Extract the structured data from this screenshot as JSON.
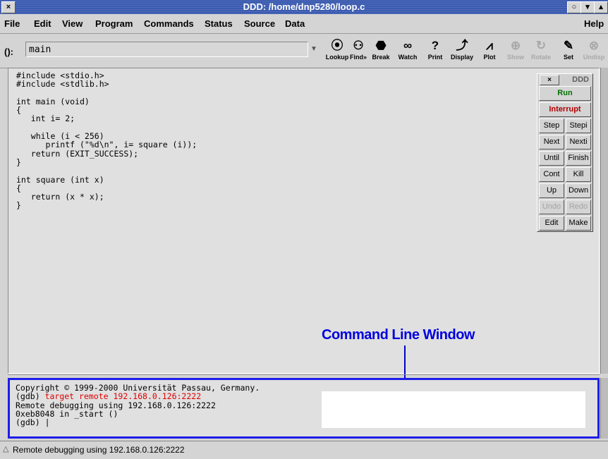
{
  "window": {
    "title": "DDD: /home/dnp5280/loop.c"
  },
  "titlebar_buttons": {
    "left": "×",
    "right": [
      "○",
      "▾",
      "▴"
    ]
  },
  "menu": {
    "items": [
      "File",
      "Edit",
      "View",
      "Program",
      "Commands",
      "Status",
      "Source",
      "Data"
    ],
    "help": "Help"
  },
  "argfield": {
    "label": "():",
    "value": "main"
  },
  "toolbar": {
    "buttons": [
      {
        "label": "Lookup",
        "icon": "lookup-icon",
        "glyph": "⦿"
      },
      {
        "label": "Find»",
        "icon": "find-icon",
        "glyph": "⚇"
      },
      {
        "label": "Break",
        "icon": "stop-icon",
        "glyph": "⬣"
      },
      {
        "label": "Watch",
        "icon": "watch-icon",
        "glyph": "∞"
      },
      {
        "label": "Print",
        "icon": "print-icon",
        "glyph": "?"
      },
      {
        "label": "Display",
        "icon": "display-icon",
        "glyph": "⤴"
      },
      {
        "label": "Plot",
        "icon": "plot-icon",
        "glyph": "⩘"
      },
      {
        "label": "Show",
        "icon": "show-icon",
        "glyph": "⊕"
      },
      {
        "label": "Rotate",
        "icon": "rotate-icon",
        "glyph": "↻"
      },
      {
        "label": "Set",
        "icon": "set-icon",
        "glyph": "✎"
      },
      {
        "label": "Undisp",
        "icon": "undisplay-icon",
        "glyph": "⊗"
      }
    ]
  },
  "source": {
    "code": "#include <stdio.h>\n#include <stdlib.h>\n\nint main (void)\n{\n   int i= 2;\n\n   while (i < 256)\n      printf (\"%d\\n\", i= square (i));\n   return (EXIT_SUCCESS);\n}\n\nint square (int x)\n{\n   return (x * x);\n}"
  },
  "annotation": {
    "label": "Command Line Window"
  },
  "console": {
    "line1": "Copyright © 1999-2000 Universität Passau, Germany.",
    "prompt": "(gdb)",
    "command": "target remote 192.168.0.126:2222",
    "line3": "Remote debugging using 192.168.0.126:2222",
    "line4": "0xeb8048 in _start ()",
    "prompt2": "(gdb)"
  },
  "status": {
    "text": "Remote debugging using 192.168.0.126:2222"
  },
  "command_tool": {
    "title": "DDD",
    "close": "×",
    "run": "Run",
    "interrupt": "Interrupt",
    "run_color": "#007000",
    "interrupt_color": "#b00000",
    "buttons": [
      [
        "Step",
        "Stepi"
      ],
      [
        "Next",
        "Nexti"
      ],
      [
        "Until",
        "Finish"
      ],
      [
        "Cont",
        "Kill"
      ],
      [
        "Up",
        "Down"
      ],
      [
        "Undo",
        "Redo"
      ],
      [
        "Edit",
        "Make"
      ]
    ]
  }
}
